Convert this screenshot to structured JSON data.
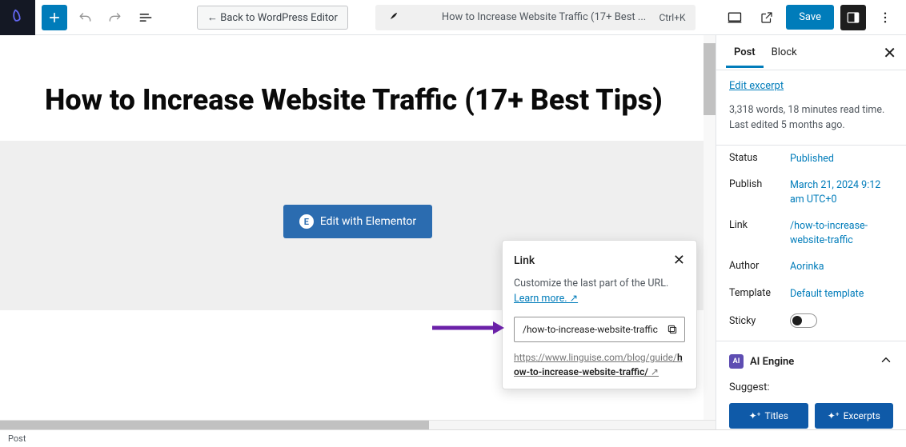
{
  "toolbar": {
    "back_label": "← Back to WordPress Editor",
    "doc_title_truncated": "How to Increase Website Traffic (17+ Best ...",
    "shortcut": "Ctrl+K",
    "save_label": "Save"
  },
  "editor": {
    "page_title": "How to Increase Website Traffic (17+ Best Tips)",
    "elementor_btn": "Edit with Elementor"
  },
  "link_popover": {
    "title": "Link",
    "description": "Customize the last part of the URL. ",
    "learn_more": "Learn more. ↗",
    "slug_value": "/how-to-increase-website-traffic",
    "full_url_prefix": "https://www.linguise.com/blog/guide/",
    "full_url_slug": "how-to-increase-website-traffic/"
  },
  "sidebar": {
    "tabs": {
      "post": "Post",
      "block": "Block"
    },
    "edit_excerpt": "Edit excerpt",
    "stats": "3,318 words, 18 minutes read time. Last edited 5 months ago.",
    "fields": {
      "status": {
        "label": "Status",
        "value": "Published"
      },
      "publish": {
        "label": "Publish",
        "value": "March 21, 2024 9:12 am UTC+0"
      },
      "link": {
        "label": "Link",
        "value": "/how-to-increase-website-traffic"
      },
      "author": {
        "label": "Author",
        "value": "Aorinka"
      },
      "template": {
        "label": "Template",
        "value": "Default template"
      },
      "sticky": {
        "label": "Sticky"
      }
    },
    "ai": {
      "title": "AI Engine",
      "suggest_label": "Suggest:",
      "titles_btn": "Titles",
      "excerpts_btn": "Excerpts"
    }
  },
  "bottom_status": "Post"
}
